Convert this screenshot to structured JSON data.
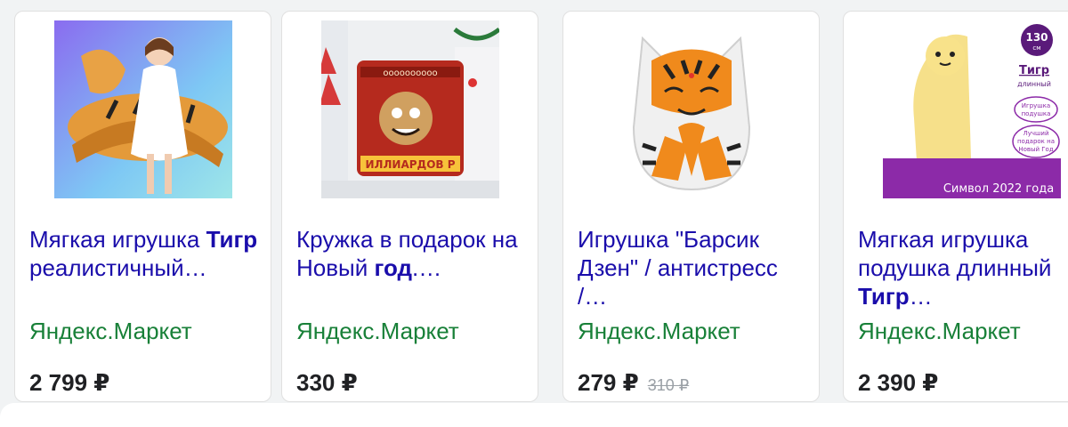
{
  "products": [
    {
      "title_before": "Мягкая игрушка ",
      "title_bold": "Тигр",
      "title_after": " реалистичный…",
      "store": "Яндекс.Маркет",
      "price": "2 799 ₽",
      "old_price": ""
    },
    {
      "title_before": "Кружка в подарок на Новый ",
      "title_bold": "год",
      "title_after": ".…",
      "store": "Яндекс.Маркет",
      "price": "330 ₽",
      "old_price": ""
    },
    {
      "title_before": "Игрушка \"Барсик Дзен\" / антистресс /…",
      "title_bold": "",
      "title_after": "",
      "store": "Яндекс.Маркет",
      "price": "279 ₽",
      "old_price": "310 ₽"
    },
    {
      "title_before": "Мягкая игрушка подушка длинный ",
      "title_bold": "Тигр",
      "title_after": "…",
      "store": "Яндекс.Маркет",
      "price": "2 390 ₽",
      "old_price": ""
    }
  ],
  "images": {
    "mug_text": "ИЛЛИАРДОВ Р",
    "pillow_badge_number": "130",
    "pillow_badge_unit": "см",
    "pillow_heading_1": "Тигр",
    "pillow_heading_2": "длинный",
    "pillow_note_1a": "Игрушка",
    "pillow_note_1b": "подушка",
    "pillow_note_2a": "Лучший",
    "pillow_note_2b": "подарок на",
    "pillow_note_2c": "Новый Год",
    "pillow_footer": "Символ 2022 года"
  },
  "colors": {
    "link": "#1a0dab",
    "store": "#188038",
    "price": "#202124"
  }
}
